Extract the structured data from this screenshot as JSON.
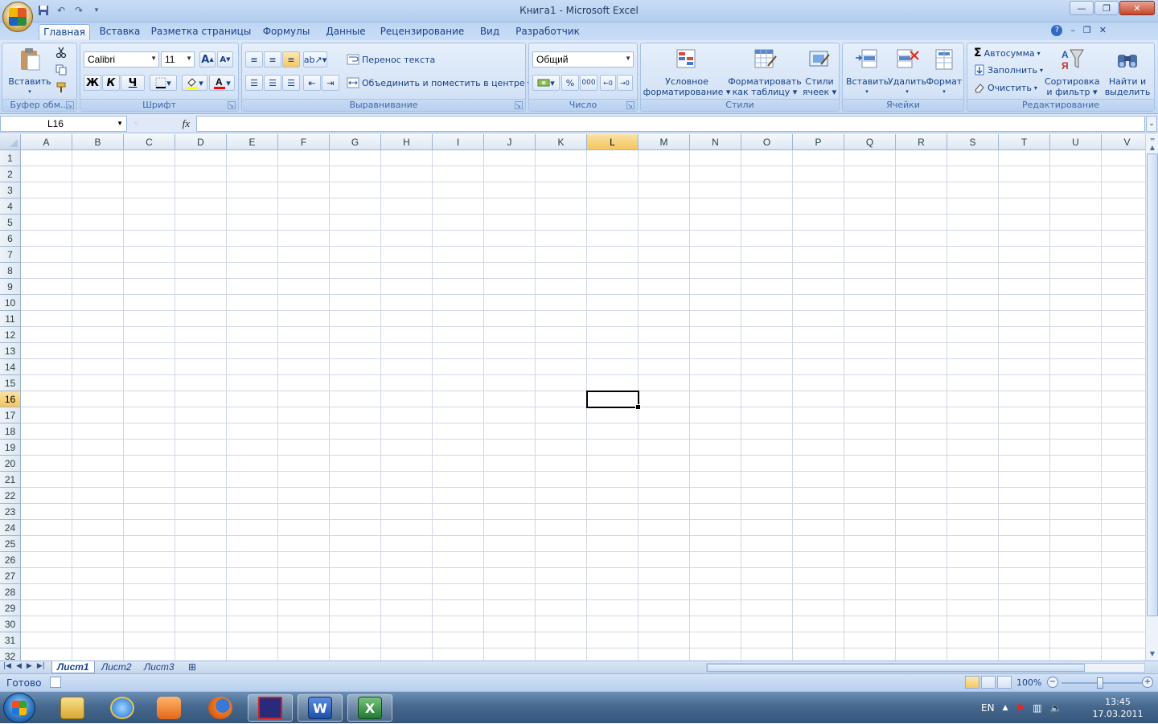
{
  "window": {
    "title": "Книга1 - Microsoft Excel"
  },
  "tabs": [
    {
      "label": "Главная",
      "active": true
    },
    {
      "label": "Вставка"
    },
    {
      "label": "Разметка страницы"
    },
    {
      "label": "Формулы"
    },
    {
      "label": "Данные"
    },
    {
      "label": "Рецензирование"
    },
    {
      "label": "Вид"
    },
    {
      "label": "Разработчик"
    }
  ],
  "ribbon": {
    "clipboard": {
      "label": "Буфер обм...",
      "paste": "Вставить"
    },
    "font": {
      "label": "Шрифт",
      "family": "Calibri",
      "size": "11",
      "bold": "Ж",
      "italic": "К",
      "underline": "Ч",
      "fill_color": "#ffff00",
      "font_color": "#ff0000"
    },
    "alignment": {
      "label": "Выравнивание",
      "wrap": "Перенос текста",
      "merge": "Объединить и поместить в центре"
    },
    "number": {
      "label": "Число",
      "format": "Общий",
      "percent": "%",
      "thousands": "000"
    },
    "styles": {
      "label": "Стили",
      "conditional_1": "Условное",
      "conditional_2": "форматирование",
      "table_1": "Форматировать",
      "table_2": "как таблицу",
      "cell_styles_1": "Стили",
      "cell_styles_2": "ячеек"
    },
    "cells": {
      "label": "Ячейки",
      "insert": "Вставить",
      "delete": "Удалить",
      "format": "Формат"
    },
    "editing": {
      "label": "Редактирование",
      "autosum": "Автосумма",
      "fill": "Заполнить",
      "clear": "Очистить",
      "sort_1": "Сортировка",
      "sort_2": "и фильтр",
      "find_1": "Найти и",
      "find_2": "выделить"
    }
  },
  "formula_bar": {
    "name_box": "L16",
    "fx": "fx",
    "formula": ""
  },
  "grid": {
    "columns": [
      "A",
      "B",
      "C",
      "D",
      "E",
      "F",
      "G",
      "H",
      "I",
      "J",
      "K",
      "L",
      "M",
      "N",
      "O",
      "P",
      "Q",
      "R",
      "S",
      "T",
      "U",
      "V"
    ],
    "rows": [
      "1",
      "2",
      "3",
      "4",
      "5",
      "6",
      "7",
      "8",
      "9",
      "10",
      "11",
      "12",
      "13",
      "14",
      "15",
      "16",
      "17",
      "18",
      "19",
      "20",
      "21",
      "22",
      "23",
      "24",
      "25",
      "26",
      "27",
      "28",
      "29",
      "30",
      "31",
      "32"
    ],
    "selected_column": "L",
    "selected_row": "16"
  },
  "sheets": [
    {
      "label": "Лист1",
      "active": true
    },
    {
      "label": "Лист2"
    },
    {
      "label": "Лист3"
    }
  ],
  "status": {
    "ready": "Готово",
    "zoom": "100%"
  },
  "taskbar": {
    "lang": "EN",
    "time": "13:45",
    "date": "17.03.2011"
  },
  "icons": [
    "office-button-icon",
    "save-icon",
    "undo-icon",
    "redo-icon",
    "paste-icon",
    "cut-icon",
    "copy-icon",
    "format-painter-icon",
    "borders-icon",
    "fill-color-icon",
    "font-color-icon",
    "wrap-text-icon",
    "merge-center-icon",
    "currency-icon",
    "conditional-formatting-icon",
    "format-as-table-icon",
    "cell-styles-icon",
    "insert-cells-icon",
    "delete-cells-icon",
    "format-cells-icon",
    "autosum-icon",
    "fill-icon",
    "clear-icon",
    "sort-filter-icon",
    "find-select-icon",
    "start-icon",
    "explorer-icon",
    "ie-icon",
    "media-player-icon",
    "firefox-icon",
    "floppy-icon",
    "word-icon",
    "excel-icon"
  ]
}
